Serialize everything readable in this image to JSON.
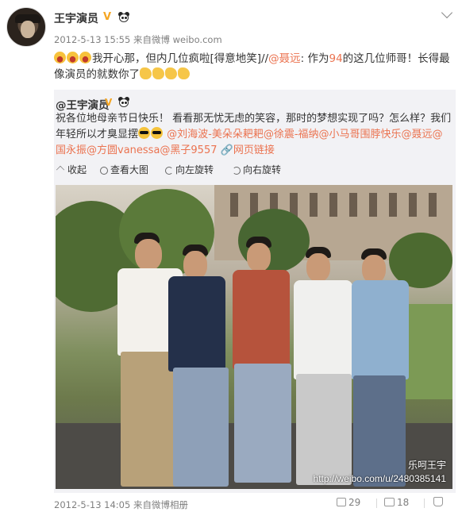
{
  "post": {
    "author": "王宇演员",
    "timestamp": "2012-5-13 15:55",
    "source": "来自微博 weibo.com",
    "text_after_emoji": "我开心那，但内几位疯啦[得意地笑]//",
    "mention": "@聂远",
    "text_mid": ": 作为",
    "highlight": "94",
    "text_end": "的这几位师哥！长得最像演员的就数你了"
  },
  "repost": {
    "author": "@王宇演员",
    "text": "祝各位地母亲节日快乐！ 看看那无忧无虑的笑容，那时的梦想实现了吗？怎么样？我们年轻所以才臭显摆",
    "mentions": "@刘海波-美朵朵耙耙@徐震-福纳@小马哥围脖快乐@聂远@国永振@方圆vanessa@黑子9557",
    "web_link": "网页链接",
    "actions": {
      "collapse": "收起",
      "view_large": "查看大图",
      "rotate_left": "向左旋转",
      "rotate_right": "向右旋转"
    },
    "watermark_name": "乐呵王宇",
    "watermark_url": "http://weibo.com/u/2480385141"
  },
  "footer": {
    "timestamp": "2012-5-13 14:05",
    "source": "来自微博相册",
    "repost_count": "29",
    "comment_count": "18",
    "like_count": ""
  },
  "colors": {
    "link": "#eb7350",
    "verified": "#f5a623",
    "repost_bg": "#f2f2f5"
  }
}
